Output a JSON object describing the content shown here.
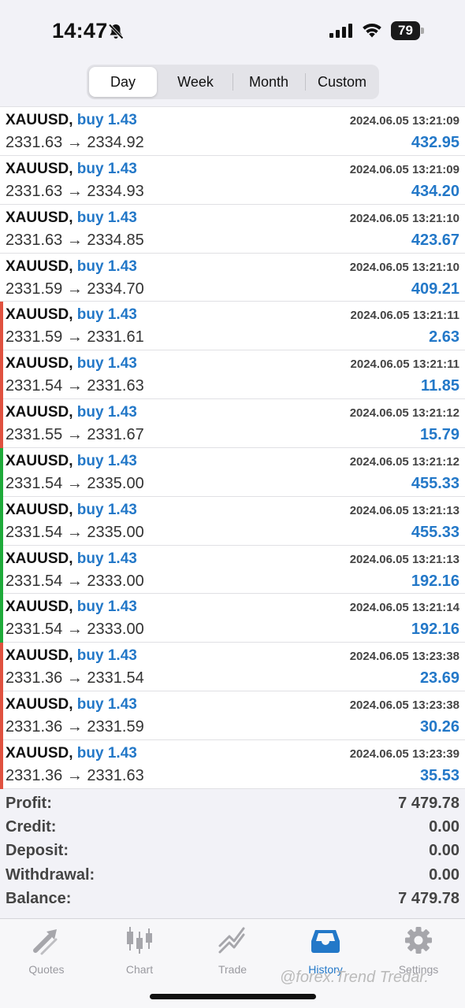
{
  "status_bar": {
    "time": "14:47",
    "battery": "79"
  },
  "period_tabs": [
    {
      "label": "Day",
      "active": true
    },
    {
      "label": "Week",
      "active": false
    },
    {
      "label": "Month",
      "active": false
    },
    {
      "label": "Custom",
      "active": false
    }
  ],
  "deals": [
    {
      "symbol": "XAUUSD,",
      "side": "buy 1.43",
      "prices": "2331.63 → 2334.92",
      "time": "2024.06.05 13:21:09",
      "profit": "432.95",
      "bar": "none"
    },
    {
      "symbol": "XAUUSD,",
      "side": "buy 1.43",
      "prices": "2331.63 → 2334.93",
      "time": "2024.06.05 13:21:09",
      "profit": "434.20",
      "bar": "none"
    },
    {
      "symbol": "XAUUSD,",
      "side": "buy 1.43",
      "prices": "2331.63 → 2334.85",
      "time": "2024.06.05 13:21:10",
      "profit": "423.67",
      "bar": "none"
    },
    {
      "symbol": "XAUUSD,",
      "side": "buy 1.43",
      "prices": "2331.59 → 2334.70",
      "time": "2024.06.05 13:21:10",
      "profit": "409.21",
      "bar": "none"
    },
    {
      "symbol": "XAUUSD,",
      "side": "buy 1.43",
      "prices": "2331.59 → 2331.61",
      "time": "2024.06.05 13:21:11",
      "profit": "2.63",
      "bar": "red"
    },
    {
      "symbol": "XAUUSD,",
      "side": "buy 1.43",
      "prices": "2331.54 → 2331.63",
      "time": "2024.06.05 13:21:11",
      "profit": "11.85",
      "bar": "red"
    },
    {
      "symbol": "XAUUSD,",
      "side": "buy 1.43",
      "prices": "2331.55 → 2331.67",
      "time": "2024.06.05 13:21:12",
      "profit": "15.79",
      "bar": "red"
    },
    {
      "symbol": "XAUUSD,",
      "side": "buy 1.43",
      "prices": "2331.54 → 2335.00",
      "time": "2024.06.05 13:21:12",
      "profit": "455.33",
      "bar": "green"
    },
    {
      "symbol": "XAUUSD,",
      "side": "buy 1.43",
      "prices": "2331.54 → 2335.00",
      "time": "2024.06.05 13:21:13",
      "profit": "455.33",
      "bar": "green"
    },
    {
      "symbol": "XAUUSD,",
      "side": "buy 1.43",
      "prices": "2331.54 → 2333.00",
      "time": "2024.06.05 13:21:13",
      "profit": "192.16",
      "bar": "green"
    },
    {
      "symbol": "XAUUSD,",
      "side": "buy 1.43",
      "prices": "2331.54 → 2333.00",
      "time": "2024.06.05 13:21:14",
      "profit": "192.16",
      "bar": "green"
    },
    {
      "symbol": "XAUUSD,",
      "side": "buy 1.43",
      "prices": "2331.36 → 2331.54",
      "time": "2024.06.05 13:23:38",
      "profit": "23.69",
      "bar": "red"
    },
    {
      "symbol": "XAUUSD,",
      "side": "buy 1.43",
      "prices": "2331.36 → 2331.59",
      "time": "2024.06.05 13:23:38",
      "profit": "30.26",
      "bar": "red"
    },
    {
      "symbol": "XAUUSD,",
      "side": "buy 1.43",
      "prices": "2331.36 → 2331.63",
      "time": "2024.06.05 13:23:39",
      "profit": "35.53",
      "bar": "red"
    }
  ],
  "summary": [
    {
      "label": "Profit:",
      "value": "7 479.78"
    },
    {
      "label": "Credit:",
      "value": "0.00"
    },
    {
      "label": "Deposit:",
      "value": "0.00"
    },
    {
      "label": "Withdrawal:",
      "value": "0.00"
    },
    {
      "label": "Balance:",
      "value": "7 479.78"
    }
  ],
  "tabbar": [
    {
      "label": "Quotes",
      "icon": "quotes-icon",
      "active": false
    },
    {
      "label": "Chart",
      "icon": "chart-icon",
      "active": false
    },
    {
      "label": "Trade",
      "icon": "trade-icon",
      "active": false
    },
    {
      "label": "History",
      "icon": "history-icon",
      "active": true
    },
    {
      "label": "Settings",
      "icon": "settings-icon",
      "active": false
    }
  ],
  "watermark": "@forex.Trend Tredar.",
  "colors": {
    "accent": "#2378c8",
    "loss_bar": "#e0513f",
    "gain_bar": "#1faa3a",
    "inactive": "#9a9aa0"
  }
}
